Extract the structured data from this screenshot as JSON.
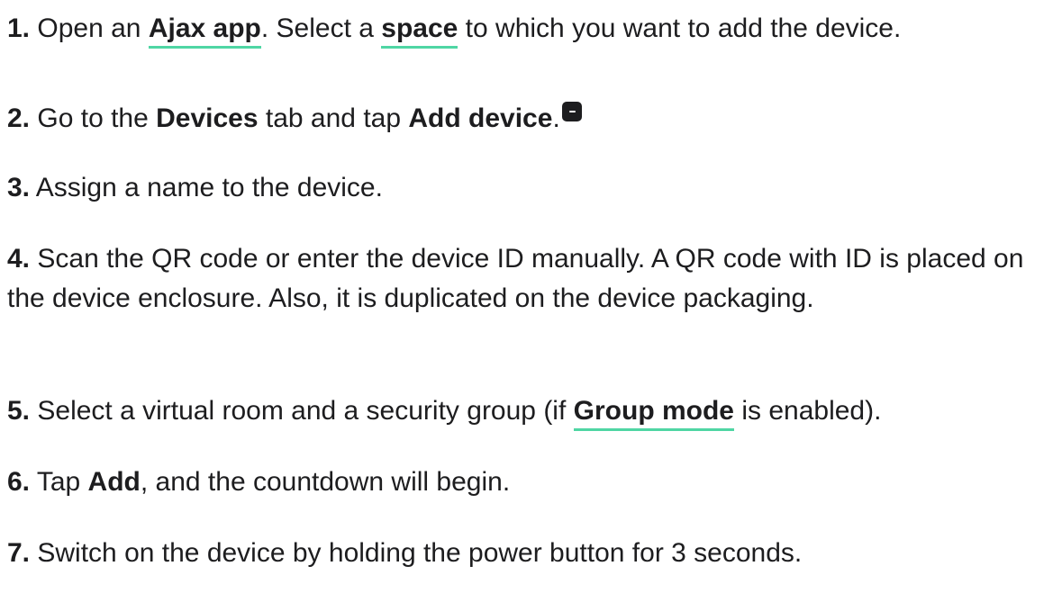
{
  "steps": [
    {
      "num": "1.",
      "t1": "Open an ",
      "link1": "Ajax app",
      "t2": ". Select a ",
      "link2": "space",
      "t3": " to which you want to add the device."
    },
    {
      "num": "2.",
      "t1": "Go to the ",
      "b1": "Devices",
      "t2": " tab and tap ",
      "b2": "Add device",
      "t3": ".",
      "icon": "plus-icon"
    },
    {
      "num": "3.",
      "t1": "Assign a name to the device."
    },
    {
      "num": "4.",
      "t1": "Scan the QR code or enter the device ID manually. A QR code with ID is placed on the device enclosure. Also, it is duplicated on the device packaging."
    },
    {
      "num": "5.",
      "t1": "Select a virtual room and a security group (if ",
      "link1": "Group mode",
      "t2": " is enabled)."
    },
    {
      "num": "6.",
      "t1": "Tap ",
      "b1": "Add",
      "t2": ", and the countdown will begin."
    },
    {
      "num": "7.",
      "t1": "Switch on the device by holding the power button for 3 seconds."
    }
  ],
  "colors": {
    "text": "#1d1d1f",
    "link_underline": "#4fd6a4"
  }
}
